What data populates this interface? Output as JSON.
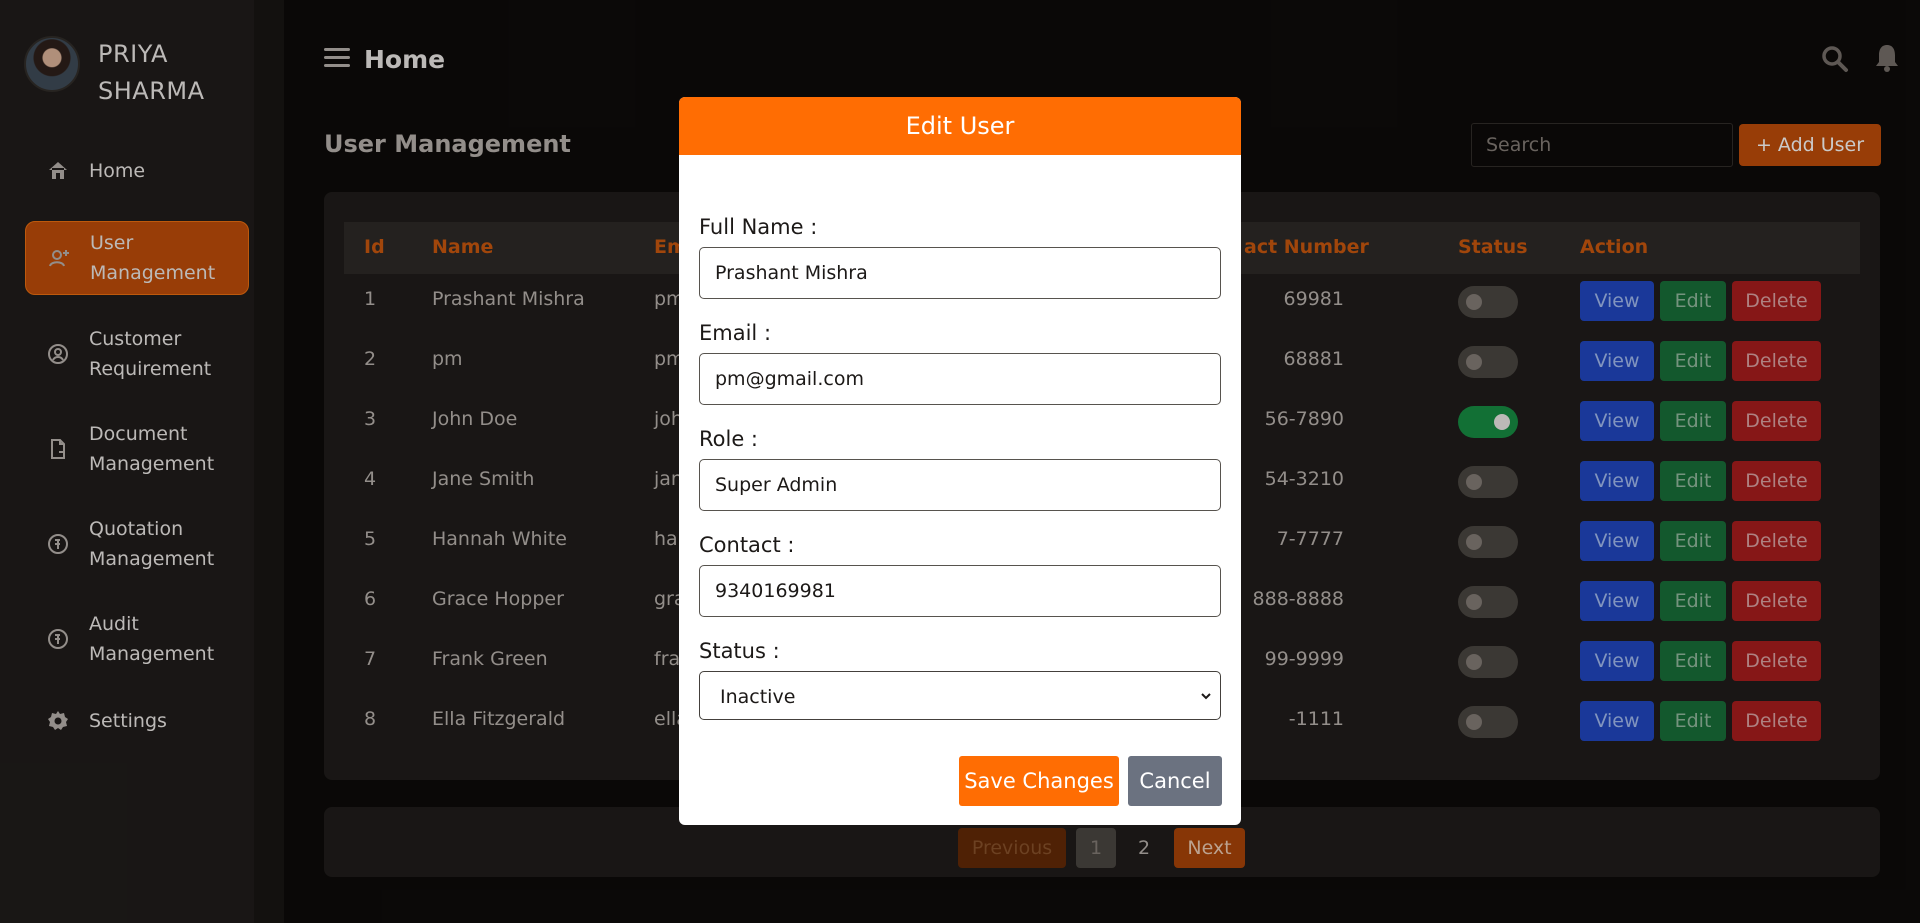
{
  "profile": {
    "name": "PRIYA SHARMA"
  },
  "sidebar": {
    "items": [
      {
        "label": "Home",
        "icon": "home-icon"
      },
      {
        "label": "User Management",
        "icon": "user-plus-icon",
        "active": true
      },
      {
        "label": "Customer Requirement",
        "icon": "customer-icon"
      },
      {
        "label": "Document Management",
        "icon": "document-icon"
      },
      {
        "label": "Quotation Management",
        "icon": "quotation-icon"
      },
      {
        "label": "Audit Management",
        "icon": "audit-icon"
      },
      {
        "label": "Settings",
        "icon": "gear-icon"
      }
    ]
  },
  "header": {
    "title": "Home"
  },
  "main": {
    "title": "User Management",
    "search_placeholder": "Search",
    "add_user_label": "+ Add User"
  },
  "table": {
    "columns": [
      "Id",
      "Name",
      "Em",
      "act Number",
      "Status",
      "Action"
    ],
    "rows": [
      {
        "id": "1",
        "name": "Prashant Mishra",
        "email": "pm",
        "contact": "69981",
        "status_on": false
      },
      {
        "id": "2",
        "name": "pm",
        "email": "pm",
        "contact": "68881",
        "status_on": false
      },
      {
        "id": "3",
        "name": "John Doe",
        "email": "joh",
        "contact": "56-7890",
        "status_on": true
      },
      {
        "id": "4",
        "name": "Jane Smith",
        "email": "jan",
        "contact": "54-3210",
        "status_on": false
      },
      {
        "id": "5",
        "name": "Hannah White",
        "email": "ha",
        "contact": "7-7777",
        "status_on": false
      },
      {
        "id": "6",
        "name": "Grace Hopper",
        "email": "gra",
        "contact": "888-8888",
        "status_on": false
      },
      {
        "id": "7",
        "name": "Frank Green",
        "email": "fra",
        "contact": "99-9999",
        "status_on": false
      },
      {
        "id": "8",
        "name": "Ella Fitzgerald",
        "email": "ella",
        "contact": "-1111",
        "status_on": false
      }
    ],
    "view_label": "View",
    "edit_label": "Edit",
    "delete_label": "Delete"
  },
  "pagination": {
    "previous": "Previous",
    "page1": "1",
    "page2": "2",
    "next": "Next"
  },
  "modal": {
    "title": "Edit User",
    "full_name_label": "Full Name :",
    "full_name_value": "Prashant Mishra",
    "email_label": "Email :",
    "email_value": "pm@gmail.com",
    "role_label": "Role :",
    "role_value": "Super Admin",
    "contact_label": "Contact :",
    "contact_value": "9340169981",
    "status_label": "Status :",
    "status_value": "Inactive",
    "save_label": "Save Changes",
    "cancel_label": "Cancel"
  },
  "colors": {
    "accent": "#ff6d03",
    "background": "#0c0a09",
    "sidebar": "#1d1a18"
  }
}
